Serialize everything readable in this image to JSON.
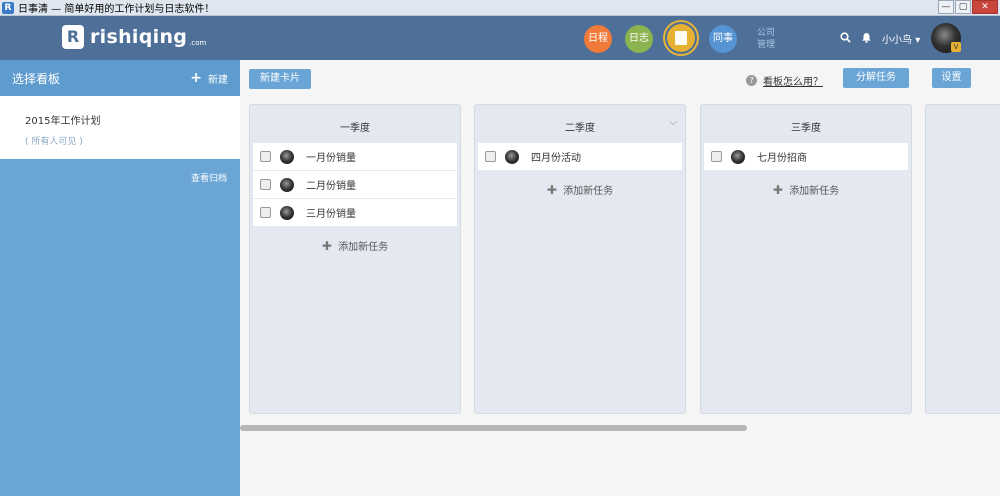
{
  "window": {
    "title": "日事清 — 简单好用的工作计划与日志软件！",
    "controls": [
      "—",
      "▢",
      "✕"
    ]
  },
  "header": {
    "logo_text": "rishiqing",
    "logo_suffix": ".com",
    "nav": {
      "schedule": "日程",
      "log": "日志",
      "colleague": "同事"
    },
    "company_mgmt_line1": "公司",
    "company_mgmt_line2": "管理",
    "username": "小小鸟",
    "badge": "V"
  },
  "sidebar": {
    "title": "选择看板",
    "new_label": "新建",
    "boards": [
      {
        "name": "2015年工作计划",
        "visibility": "( 所有人可见 )"
      }
    ],
    "view_archive": "查看归档"
  },
  "toolbar": {
    "new_card": "新建卡片",
    "help_text": "看板怎么用？",
    "decompose": "分解任务",
    "settings": "设置"
  },
  "columns": [
    {
      "title": "一季度",
      "tasks": [
        "一月份销量",
        "二月份销量",
        "三月份销量"
      ],
      "add_label": "添加新任务"
    },
    {
      "title": "二季度",
      "tasks": [
        "四月份活动"
      ],
      "add_label": "添加新任务"
    },
    {
      "title": "三季度",
      "tasks": [
        "七月份招商"
      ],
      "add_label": "添加新任务"
    }
  ],
  "colors": {
    "header": "#4e6f98",
    "sidebar": "#6aa5d6",
    "schedule": "#ef7a39",
    "log": "#8bb451",
    "board": "#e6b133",
    "colleague": "#5693d2"
  }
}
